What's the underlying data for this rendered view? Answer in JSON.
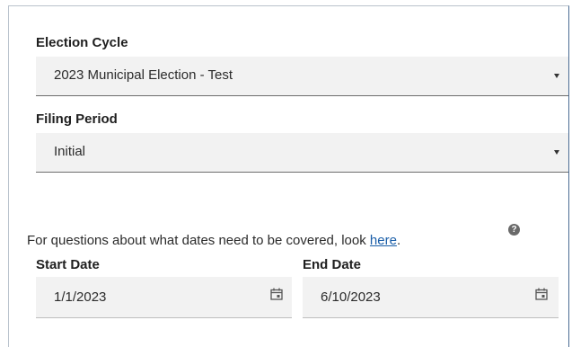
{
  "election_cycle": {
    "label": "Election Cycle",
    "value": "2023 Municipal Election - Test"
  },
  "filing_period": {
    "label": "Filing Period",
    "value": "Initial"
  },
  "info": {
    "text": "For questions about what dates need to be covered, look ",
    "link": "here",
    "suffix": ".",
    "help_glyph": "?"
  },
  "start_date": {
    "label": "Start Date",
    "value": "1/1/2023"
  },
  "end_date": {
    "label": "End Date",
    "value": "6/10/2023"
  },
  "icons": {
    "dropdown": "chevron-down-icon",
    "calendar": "calendar-icon",
    "help": "help-icon"
  },
  "colors": {
    "link": "#1a5ea8",
    "field_background": "#f2f2f2",
    "panel_border_right": "#4a6b93"
  }
}
